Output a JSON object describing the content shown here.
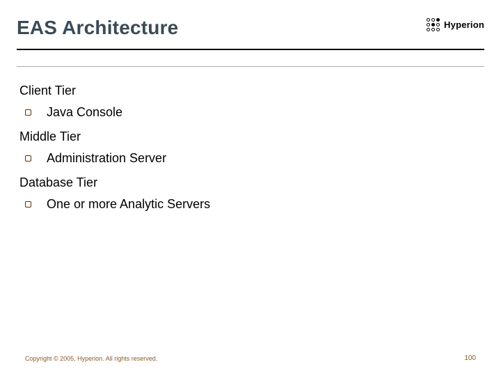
{
  "header": {
    "title": "EAS Architecture",
    "brand": "Hyperion"
  },
  "sections": [
    {
      "label": "Client Tier",
      "item": "Java Console"
    },
    {
      "label": "Middle Tier",
      "item": "Administration Server"
    },
    {
      "label": "Database Tier",
      "item": "One or more Analytic Servers"
    }
  ],
  "footer": {
    "copyright": "Copyright © 2005, Hyperion. All rights reserved.",
    "page": "100"
  }
}
